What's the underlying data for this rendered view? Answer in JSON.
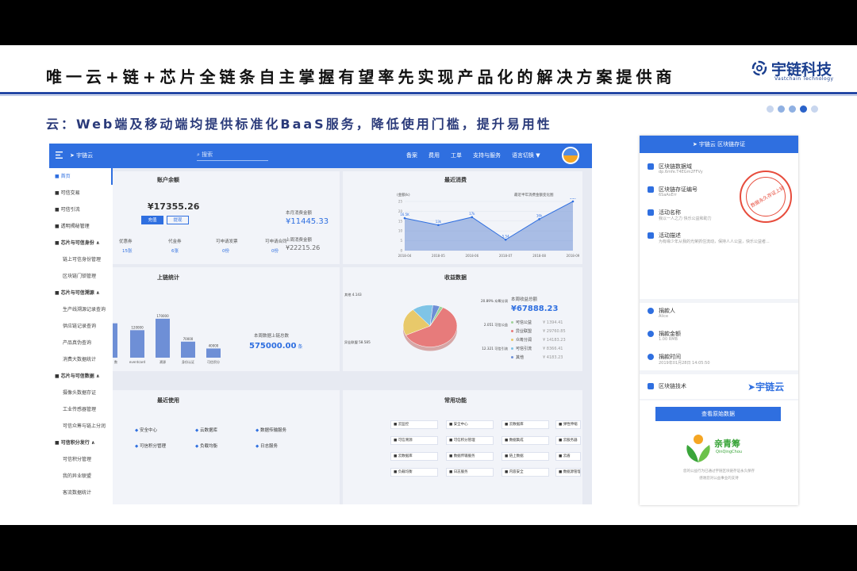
{
  "slide": {
    "title": "唯一云+链+芯片全链条自主掌握有望率先实现产品化的解决方案提供商",
    "subtitle": "云：Web端及移动端均提供标准化BaaS服务，降低使用门槛，提升易用性",
    "logo_cn": "宇链科技",
    "logo_en": "Vastchain Technology",
    "page_dots": 5,
    "active_dot": 3
  },
  "dashboard": {
    "brand": "宇链云",
    "search_placeholder": "搜索",
    "nav": [
      "备案",
      "费用",
      "工单",
      "支持与服务",
      "语言切换 ▼"
    ],
    "side_menu": [
      {
        "label": "首页",
        "type": "active"
      },
      {
        "label": "可信交易",
        "type": "item"
      },
      {
        "label": "可信引流",
        "type": "item"
      },
      {
        "label": "透明揭秘管理",
        "type": "item"
      },
      {
        "label": "芯片与可信身份 ∧",
        "type": "group"
      },
      {
        "label": "链上可信身份管理",
        "type": "sub"
      },
      {
        "label": "区块链门锁管理",
        "type": "sub"
      },
      {
        "label": "芯片与可信溯源 ∧",
        "type": "group"
      },
      {
        "label": "生产线溯源记录查询",
        "type": "sub"
      },
      {
        "label": "供应链记录查询",
        "type": "sub"
      },
      {
        "label": "产品真伪查询",
        "type": "sub"
      },
      {
        "label": "消费大数据统计",
        "type": "sub"
      },
      {
        "label": "芯片与可信数据 ∧",
        "type": "group"
      },
      {
        "label": "摄像头数据存证",
        "type": "sub"
      },
      {
        "label": "工业传感器管理",
        "type": "sub"
      },
      {
        "label": "可信众筹与链上分润",
        "type": "sub"
      },
      {
        "label": "可信积分发行 ∧",
        "type": "group"
      },
      {
        "label": "可信积分管理",
        "type": "sub"
      },
      {
        "label": "我的异业联盟",
        "type": "sub"
      },
      {
        "label": "客流数据统计",
        "type": "sub"
      }
    ],
    "account": {
      "title": "账户余额",
      "balance": "¥17355.26",
      "btn_recharge": "充值",
      "btn_withdraw": "提现",
      "stats": [
        {
          "label": "优惠券",
          "value": "15张"
        },
        {
          "label": "代金券",
          "value": "6张"
        },
        {
          "label": "可申请发票",
          "value": "0份"
        },
        {
          "label": "可申请合同",
          "value": "0份"
        }
      ]
    },
    "consumption": {
      "title": "最近消费",
      "this_month_label": "本月消费金额",
      "this_month": "¥11445.33",
      "last_month_label": "上周消费金额",
      "last_month": "¥22215.26",
      "unit_label": "(金额/k)",
      "chart_hint": "最近半年消费金额变化图"
    },
    "onchain": {
      "title": "上链统计",
      "total_label": "本周数据上链总数",
      "total": "575000.00",
      "total_unit": "条"
    },
    "revenue": {
      "title": "收益数据",
      "total_label": "本周收益总额",
      "total": "¥67888.23",
      "legend": [
        {
          "name": "可信公益",
          "value": "¥ 1394.41"
        },
        {
          "name": "异业联盟",
          "value": "¥ 29760.85"
        },
        {
          "name": "众筹分润",
          "value": "¥ 14183.23"
        },
        {
          "name": "可信引流",
          "value": "¥ 8366.41"
        },
        {
          "name": "其他",
          "value": "¥ 4183.23"
        }
      ],
      "callouts": [
        "其他 4.143",
        "20.89% 众筹分润",
        "2.051 可信公益",
        "12.321 可信引流",
        "异业联盟 58.585"
      ]
    },
    "recent": {
      "title": "最近使用",
      "items": [
        "安全中心",
        "云数据库",
        "数据传输服务",
        "可信积分管理",
        "负载均衡",
        "日志服务"
      ]
    },
    "functions": {
      "title": "常用功能",
      "items": [
        "云监控",
        "安全中心",
        "云数据库",
        "弹性伸缩",
        "可信溯源",
        "可信积分管理",
        "数据集成",
        "云服务器",
        "云数据库",
        "数据传输服务",
        "链上数据",
        "云盾",
        "负载均衡",
        "日志服务",
        "内容安全",
        "数据源管理统计"
      ]
    }
  },
  "chart_data": [
    {
      "type": "area",
      "title": "最近半年消费金额变化图",
      "ylabel": "(金额/k)",
      "categories": [
        "2018-04",
        "2018-05",
        "2018-06",
        "2018-07",
        "2018-08",
        "2018-09"
      ],
      "values": [
        16.5,
        13,
        17,
        5.54,
        16,
        25
      ],
      "labels": [
        "16.5K",
        "13k",
        "17k",
        "5.54",
        "16k",
        "25k"
      ],
      "ylim": [
        0,
        25
      ]
    },
    {
      "type": "bar",
      "title": "上链统计",
      "categories": [
        "",
        "eventcard",
        "溯源",
        "身份认证",
        "可信积分"
      ],
      "values": [
        150000,
        120000,
        170000,
        70000,
        40000
      ],
      "labels": [
        "",
        "120000",
        "170000",
        "70000",
        "40000"
      ]
    },
    {
      "type": "pie",
      "title": "收益数据",
      "categories": [
        "异业联盟",
        "众筹分润",
        "可信引流",
        "其他",
        "可信公益"
      ],
      "values": [
        58.585,
        20.89,
        12.321,
        4.143,
        2.051
      ]
    }
  ],
  "phone": {
    "header": "宇链云 区块链存证",
    "rows": [
      {
        "label": "区块链数据域",
        "value": "dp.6mfe.T4EGm2FFVy",
        "icon": "folder-icon"
      },
      {
        "label": "区块链存证编号",
        "value": "6SaAsErr",
        "icon": "mail-icon"
      },
      {
        "label": "活动名称",
        "value": "我以一人之力 快乐公益和助力",
        "icon": "tag-icon"
      },
      {
        "label": "活动描述",
        "value": "为有缘少年从我的光荣抓住流动，保持人人公益，快乐公益者...",
        "icon": "edit-icon"
      },
      {
        "label": "捐款人",
        "value": "Alice",
        "icon": "user-icon"
      },
      {
        "label": "捐款金额",
        "value": "1.00 RMB",
        "icon": "money-icon"
      },
      {
        "label": "捐款时间",
        "value": "2019年01月28日 14:05:50",
        "icon": "clock-icon"
      }
    ],
    "tech_label": "区块链技术",
    "tech_brand": "宇链云",
    "stamp_text": "数据永久存证上链",
    "button": "查看原始数据",
    "partner_cn": "亲青筹",
    "partner_en": "QinQingChou",
    "footer1": "您的公益行为已通过宇链区块链存证永久保存",
    "footer2": "感谢您对公益事业的支持"
  },
  "colors": {
    "accent": "#2f6fe0",
    "title_rule": "#2448a5",
    "stamp": "#e74c3c",
    "partner": "#3aa53a"
  }
}
